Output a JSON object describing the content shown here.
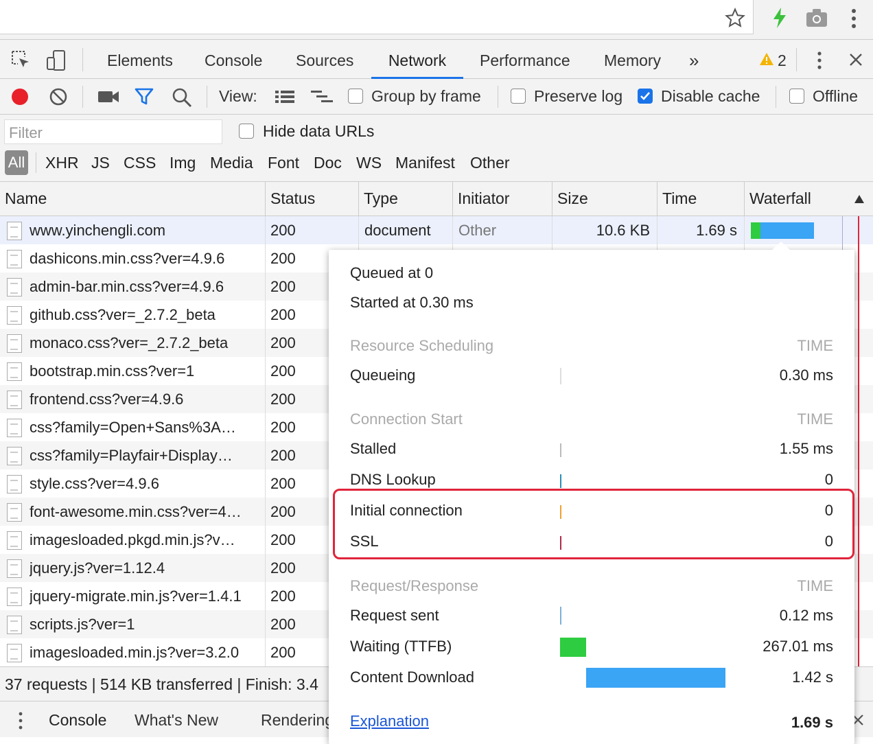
{
  "tabs": [
    "Elements",
    "Console",
    "Sources",
    "Network",
    "Performance",
    "Memory"
  ],
  "more_tabs": "»",
  "warnings_count": "2",
  "toolbar": {
    "view_label": "View:",
    "group_by_frame": "Group by frame",
    "preserve_log": "Preserve log",
    "disable_cache": "Disable cache",
    "offline": "Offline"
  },
  "filter": {
    "placeholder": "Filter",
    "hide_data_urls": "Hide data URLs"
  },
  "type_filters": [
    "All",
    "XHR",
    "JS",
    "CSS",
    "Img",
    "Media",
    "Font",
    "Doc",
    "WS",
    "Manifest",
    "Other"
  ],
  "columns": {
    "name": "Name",
    "status": "Status",
    "type": "Type",
    "initiator": "Initiator",
    "size": "Size",
    "time": "Time",
    "waterfall": "Waterfall"
  },
  "rows": [
    {
      "name": "www.yinchengli.com",
      "status": "200",
      "type": "document",
      "initiator": "Other",
      "size": "10.6 KB",
      "time": "1.69 s"
    },
    {
      "name": "dashicons.min.css?ver=4.9.6",
      "status": "200"
    },
    {
      "name": "admin-bar.min.css?ver=4.9.6",
      "status": "200"
    },
    {
      "name": "github.css?ver=_2.7.2_beta",
      "status": "200"
    },
    {
      "name": "monaco.css?ver=_2.7.2_beta",
      "status": "200"
    },
    {
      "name": "bootstrap.min.css?ver=1",
      "status": "200"
    },
    {
      "name": "frontend.css?ver=4.9.6",
      "status": "200"
    },
    {
      "name": "css?family=Open+Sans%3A…",
      "status": "200"
    },
    {
      "name": "css?family=Playfair+Display…",
      "status": "200"
    },
    {
      "name": "style.css?ver=4.9.6",
      "status": "200"
    },
    {
      "name": "font-awesome.min.css?ver=4…",
      "status": "200"
    },
    {
      "name": "imagesloaded.pkgd.min.js?v…",
      "status": "200"
    },
    {
      "name": "jquery.js?ver=1.12.4",
      "status": "200"
    },
    {
      "name": "jquery-migrate.min.js?ver=1.4.1",
      "status": "200"
    },
    {
      "name": "scripts.js?ver=1",
      "status": "200"
    },
    {
      "name": "imagesloaded.min.js?ver=3.2.0",
      "status": "200"
    }
  ],
  "footer_summary": "37 requests | 514 KB transferred | Finish: 3.4",
  "drawer_tabs": [
    "Console",
    "What's New",
    "Rendering"
  ],
  "timing": {
    "queued_at": "Queued at 0",
    "started_at": "Started at 0.30 ms",
    "sections": [
      {
        "header": "Resource Scheduling",
        "time_label": "TIME",
        "items": [
          {
            "label": "Queueing",
            "value": "0.30 ms"
          }
        ]
      },
      {
        "header": "Connection Start",
        "time_label": "TIME",
        "items": [
          {
            "label": "Stalled",
            "value": "1.55 ms"
          },
          {
            "label": "DNS Lookup",
            "value": "0"
          },
          {
            "label": "Initial connection",
            "value": "0"
          },
          {
            "label": "SSL",
            "value": "0"
          }
        ]
      },
      {
        "header": "Request/Response",
        "time_label": "TIME",
        "items": [
          {
            "label": "Request sent",
            "value": "0.12 ms"
          },
          {
            "label": "Waiting (TTFB)",
            "value": "267.01 ms"
          },
          {
            "label": "Content Download",
            "value": "1.42 s"
          }
        ]
      }
    ],
    "explanation_link": "Explanation",
    "total": "1.69 s"
  },
  "colors": {
    "accent": "#1a73e8",
    "record": "#e8202a",
    "waiting": "#2ecc40",
    "download": "#3aa4f5",
    "highlight": "#e0243a"
  }
}
